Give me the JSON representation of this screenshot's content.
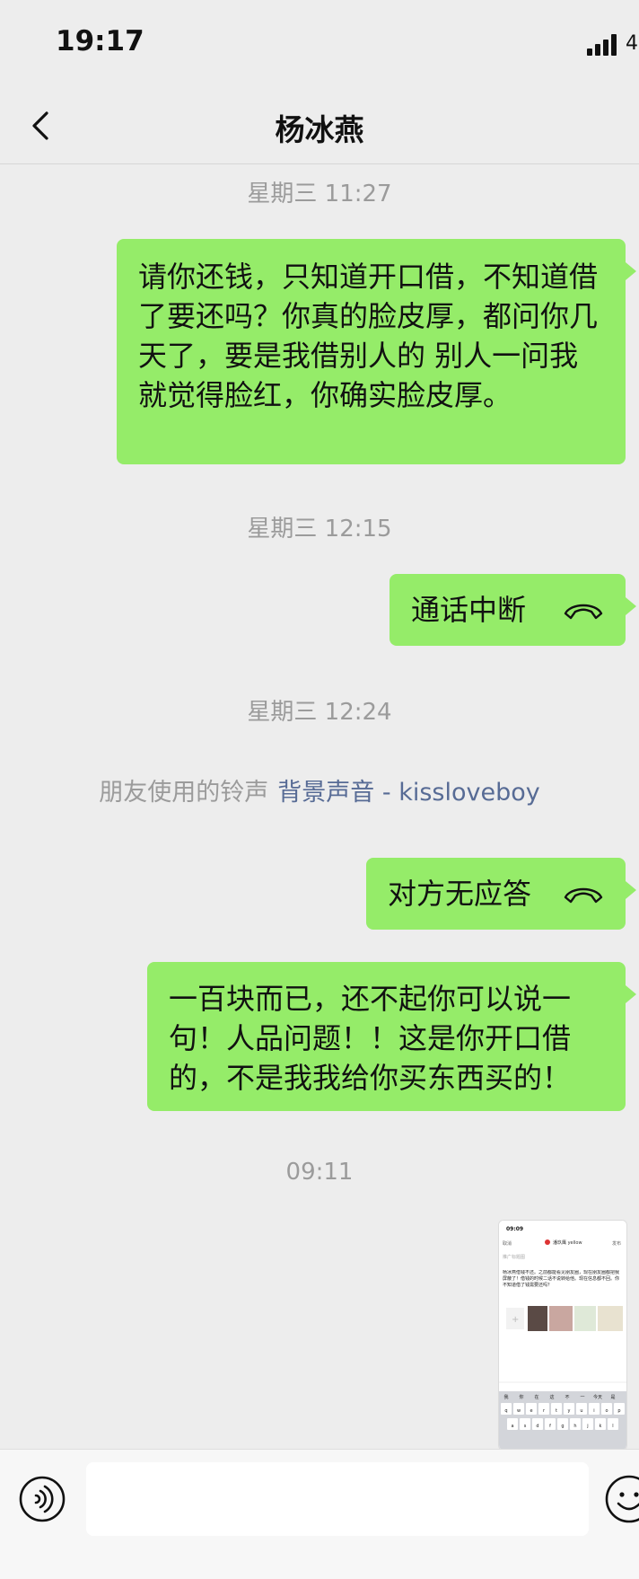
{
  "status_bar": {
    "time": "19:17",
    "battery_label": "4"
  },
  "nav": {
    "title": "杨冰燕"
  },
  "messages": [
    {
      "time": "星期三 11:27"
    },
    {
      "text": "请你还钱，只知道开口借，不知道借了要还吗？你真的脸皮厚，都问你几天了，要是我借别人的 别人一问我就觉得脸红，你确实脸皮厚。"
    },
    {
      "time": "星期三 12:15"
    },
    {
      "call": "通话中断"
    },
    {
      "time": "星期三 12:24"
    },
    {
      "ringtone_label": "朋友使用的铃声",
      "ringtone_name": "背景声音 - kissloveboy"
    },
    {
      "call": "对方无应答"
    },
    {
      "text": "一百块而已，还不起你可以说一句！人品问题！！这是你开口借的，不是我我给你买东西买的！"
    },
    {
      "time": "09:11"
    }
  ],
  "thumbnail": {
    "time": "09:09",
    "cancel": "取消",
    "account": "潘玖鹰 yellow",
    "publish": "发布",
    "hint": "推广标题图",
    "text": "杨冰燕借钱不还。之前都能看见朋友圈，现在朋友圈都把我屏蔽了！借钱的时候二话不说转给他。现在信息都不回。你不知道借了钱需要还吗？",
    "keyboard_suggestions": [
      "我",
      "你",
      "在",
      "这",
      "不",
      "一",
      "今天",
      "是"
    ],
    "keyboard_row1": [
      "q",
      "w",
      "e",
      "r",
      "t",
      "y",
      "u",
      "i",
      "o",
      "p"
    ],
    "keyboard_row2": [
      "a",
      "s",
      "d",
      "f",
      "g",
      "h",
      "j",
      "k",
      "l"
    ]
  },
  "input_bar": {
    "placeholder": ""
  },
  "colors": {
    "bubble": "#95ec69",
    "background": "#ededed",
    "link": "#576b95"
  }
}
